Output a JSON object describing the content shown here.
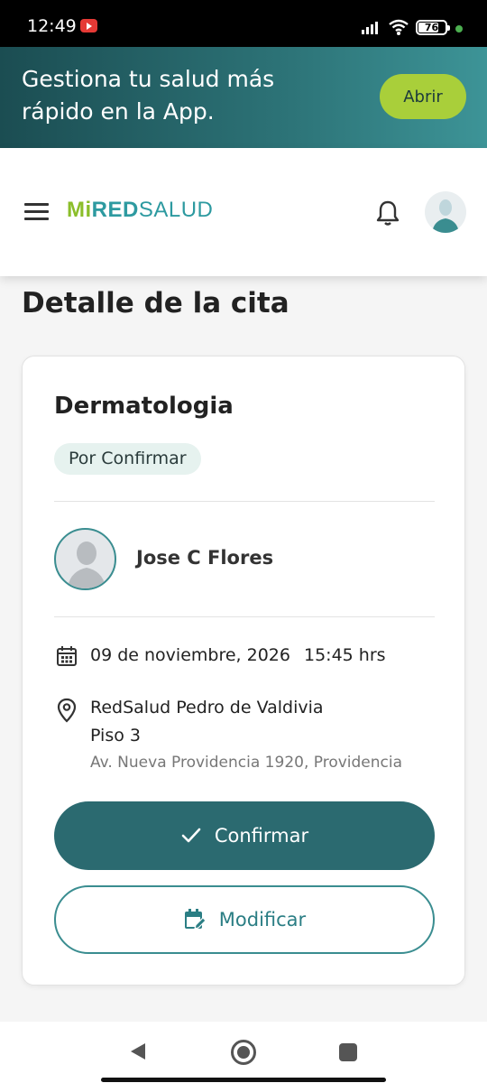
{
  "status_bar": {
    "time": "12:49",
    "battery": "76",
    "icons": [
      "youtube-icon",
      "signal-icon",
      "wifi-icon",
      "battery-icon",
      "dot-icon"
    ]
  },
  "banner": {
    "text": "Gestiona tu salud más rápido en la App.",
    "open_label": "Abrir"
  },
  "header": {
    "logo_mi": "Mi",
    "logo_red": "RED",
    "logo_salud": "SALUD",
    "icons": [
      "menu-icon",
      "bell-icon",
      "avatar"
    ]
  },
  "page": {
    "title": "Detalle de la cita"
  },
  "appointment": {
    "specialty": "Dermatologia",
    "status": "Por Confirmar",
    "doctor_name": "Jose C Flores",
    "date": "09 de noviembre, 2026",
    "time": "15:45 hrs",
    "location_name": "RedSalud Pedro de Valdivia",
    "floor": "Piso 3",
    "address": "Av. Nueva Providencia 1920, Providencia"
  },
  "actions": {
    "confirm_label": "Confirmar",
    "modify_label": "Modificar"
  },
  "colors": {
    "primary": "#2b6a70",
    "accent_green": "#a9cf3a",
    "badge_bg": "#e6f2ef"
  }
}
